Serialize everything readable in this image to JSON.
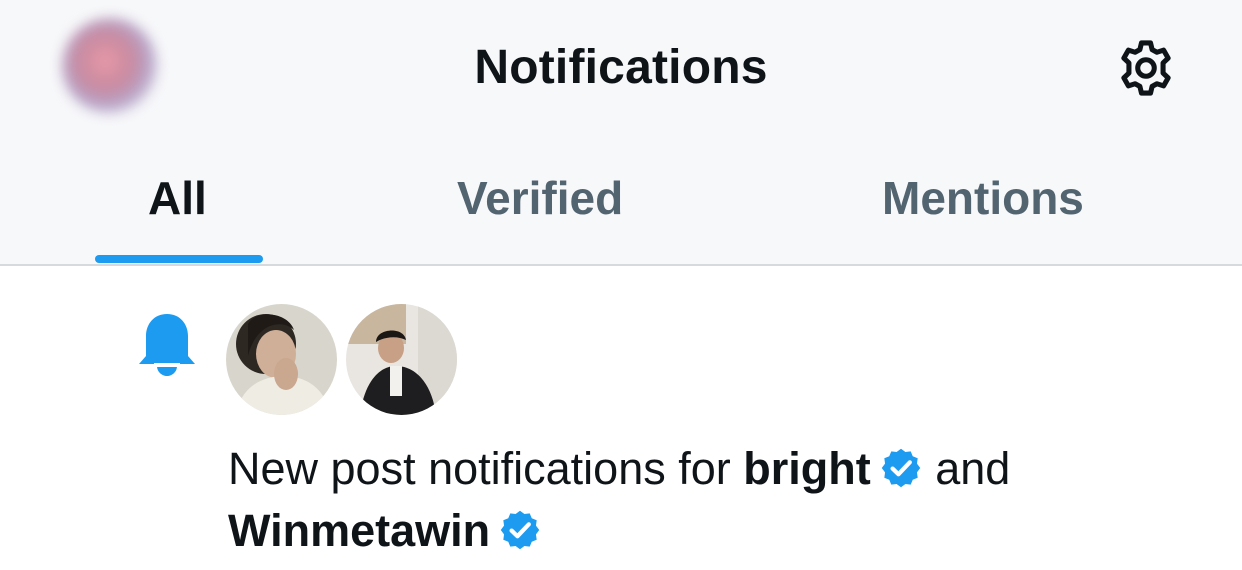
{
  "header": {
    "title": "Notifications",
    "settings_icon": "gear-icon"
  },
  "tabs": [
    {
      "label": "All",
      "active": true
    },
    {
      "label": "Verified",
      "active": false
    },
    {
      "label": "Mentions",
      "active": false
    }
  ],
  "colors": {
    "accent": "#1d9bf0",
    "text_primary": "#0f1419",
    "text_secondary": "#536471"
  },
  "notification": {
    "icon": "bell-icon",
    "text_prefix": "New post notifications for",
    "user1": "bright",
    "connector": "and",
    "user2": "Winmetawin",
    "verified_icon": "verified-badge-icon"
  }
}
